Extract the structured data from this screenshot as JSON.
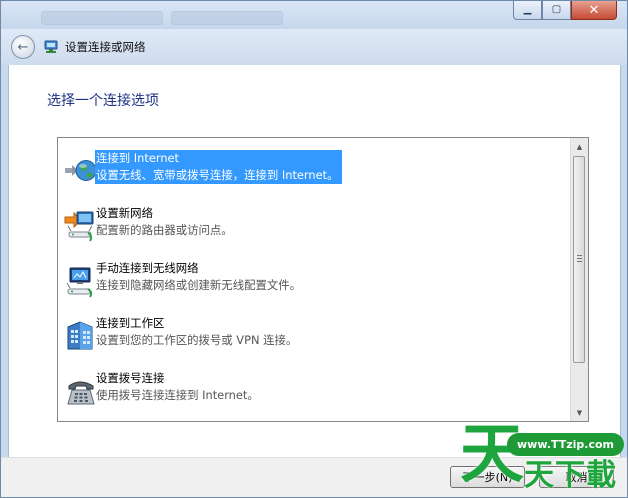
{
  "window": {
    "title": "设置连接或网络",
    "minimize_glyph": "▁",
    "maximize_glyph": "▢",
    "close_glyph": "✕",
    "back_glyph": "←"
  },
  "heading": "选择一个连接选项",
  "options": [
    {
      "title": "连接到 Internet",
      "desc": "设置无线、宽带或拨号连接，连接到 Internet。",
      "icon": "globe-icon",
      "selected": true
    },
    {
      "title": "设置新网络",
      "desc": "配置新的路由器或访问点。",
      "icon": "new-network-icon",
      "selected": false
    },
    {
      "title": "手动连接到无线网络",
      "desc": "连接到隐藏网络或创建新无线配置文件。",
      "icon": "wireless-network-icon",
      "selected": false
    },
    {
      "title": "连接到工作区",
      "desc": "设置到您的工作区的拨号或 VPN 连接。",
      "icon": "workplace-icon",
      "selected": false
    },
    {
      "title": "设置拨号连接",
      "desc": "使用拨号连接连接到 Internet。",
      "icon": "dialup-phone-icon",
      "selected": false
    }
  ],
  "buttons": {
    "next": "下一步(N)",
    "cancel": "取消"
  },
  "watermark": {
    "url": "www.TTzip.com",
    "glyph": "天",
    "text": "天下載"
  },
  "colors": {
    "selection": "#3399ff",
    "heading": "#1e3287",
    "watermark": "#1fa53e"
  }
}
